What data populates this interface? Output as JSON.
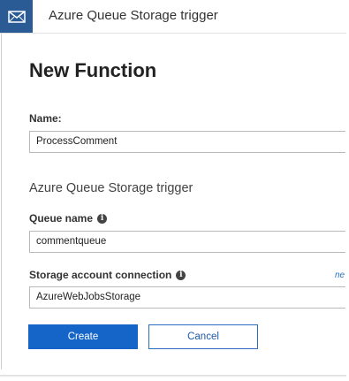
{
  "header": {
    "title": "Azure Queue Storage trigger",
    "icon": "envelope-icon"
  },
  "form": {
    "page_title": "New Function",
    "name_label": "Name:",
    "name_value": "ProcessComment",
    "section_title": "Azure Queue Storage trigger",
    "queue_label": "Queue name",
    "queue_value": "commentqueue",
    "storage_label": "Storage account connection",
    "storage_value": "AzureWebJobsStorage",
    "new_link": "ne"
  },
  "buttons": {
    "create": "Create",
    "cancel": "Cancel"
  },
  "colors": {
    "header_icon_bg": "#2a5b95",
    "primary": "#1565c8",
    "link": "#2874c7"
  }
}
